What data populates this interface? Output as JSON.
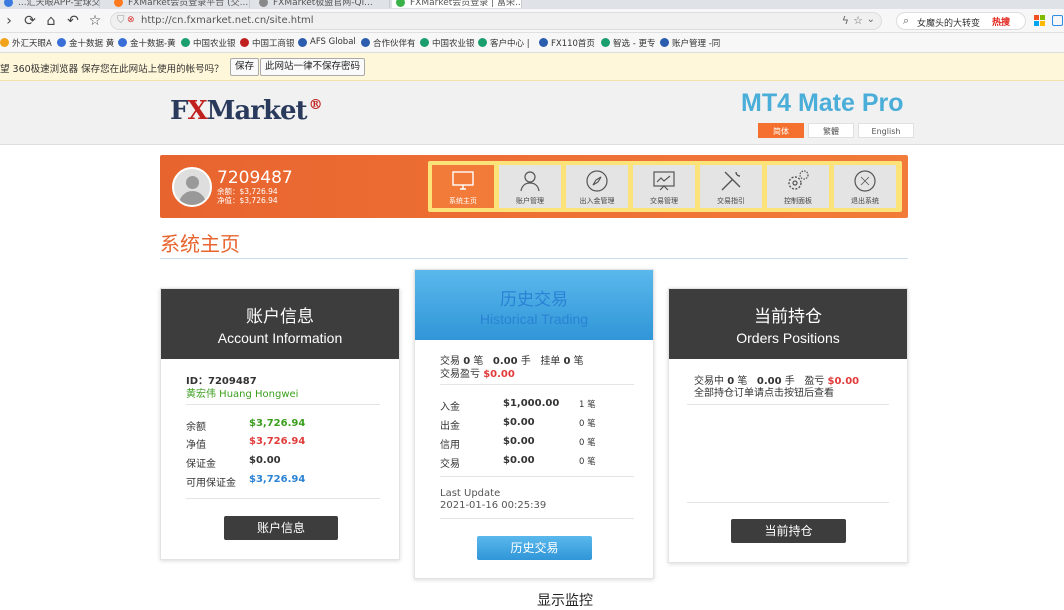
{
  "browser": {
    "tabs": [
      {
        "label": "...汇天眼APP-全球交易商监管...",
        "color": "#3b7be0"
      },
      {
        "label": "FXMarket会员登录平台 (交...",
        "color": "#ff7a1f"
      },
      {
        "label": "FXMarket极盟官网-Qi...",
        "color": "#888888"
      },
      {
        "label": "FXMarket会员登录 | 富荣...",
        "color": "#3bb14a"
      }
    ],
    "url": "http://cn.fxmarket.net.cn/site.html",
    "search_text": "女魔头的大转变",
    "hot_label": "热搜",
    "bookmarks": [
      {
        "label": "外汇天眼A",
        "color": "#f2a31b"
      },
      {
        "label": "金十数据 黄",
        "color": "#3a6fd8"
      },
      {
        "label": "金十数据-黄",
        "color": "#3a6fd8"
      },
      {
        "label": "中国农业银",
        "color": "#1a9e6e"
      },
      {
        "label": "中国工商银",
        "color": "#c0211f"
      },
      {
        "label": "AFS Global",
        "color": "#2b5cae"
      },
      {
        "label": "合作伙伴有",
        "color": "#2b5cae"
      },
      {
        "label": "中国农业银",
        "color": "#1a9e6e"
      },
      {
        "label": "客户中心 |",
        "color": "#1a9e6e"
      },
      {
        "label": "FX110首页",
        "color": "#2b5cae"
      },
      {
        "label": "智选 - 更专",
        "color": "#1a9e6e"
      },
      {
        "label": "账户管理 -同",
        "color": "#2b5cae"
      }
    ],
    "password_prompt": "望 360极速浏览器 保存您在此网站上使用的帐号吗？",
    "save_button": "保存",
    "never_button": "此网站一律不保存密码"
  },
  "header": {
    "logo_text_1": "F",
    "logo_text_x": "X",
    "logo_text_2": "Market",
    "logo_reg": "®",
    "mt4_title": "MT4 Mate Pro",
    "languages": [
      "简体",
      "繁體",
      "English"
    ]
  },
  "user": {
    "account_id": "7209487",
    "balance_line": "余额：$3,726.94",
    "equity_line": "净值：$3,726.94"
  },
  "menu": [
    {
      "label": "系统主页",
      "icon": "monitor-icon"
    },
    {
      "label": "账户管理",
      "icon": "user-icon"
    },
    {
      "label": "出入金管理",
      "icon": "compass-icon"
    },
    {
      "label": "交易管理",
      "icon": "chart-board-icon"
    },
    {
      "label": "交易指引",
      "icon": "tools-icon"
    },
    {
      "label": "控制面板",
      "icon": "gears-icon"
    },
    {
      "label": "退出系统",
      "icon": "exit-icon"
    }
  ],
  "page_title": "系统主页",
  "account_card": {
    "title_cn": "账户信息",
    "title_en": "Account Information",
    "id_line": "ID：7209487",
    "name": "黄宏伟 Huang Hongwei",
    "rows": [
      {
        "label": "余额",
        "value": "$3,726.94"
      },
      {
        "label": "净值",
        "value": "$3,726.94"
      },
      {
        "label": "保证金",
        "value": "$0.00"
      },
      {
        "label": "可用保证金",
        "value": "$3,726.94"
      }
    ],
    "button": "账户信息"
  },
  "history_card": {
    "title_cn": "历史交易",
    "title_en": "Historical Trading",
    "summary": {
      "trades_label": "交易",
      "trades_count": "0",
      "trades_unit": "笔",
      "lots": "0.00",
      "lots_unit": "手",
      "pending_label": "挂单",
      "pending_count": "0",
      "pending_unit": "笔",
      "pnl_label": "交易盈亏",
      "pnl": "$0.00"
    },
    "rows": [
      {
        "label": "入金",
        "amount": "$1,000.00",
        "count": "1 笔"
      },
      {
        "label": "出金",
        "amount": "$0.00",
        "count": "0 笔"
      },
      {
        "label": "信用",
        "amount": "$0.00",
        "count": "0 笔"
      },
      {
        "label": "交易",
        "amount": "$0.00",
        "count": "0 笔"
      }
    ],
    "last_update_label": "Last Update",
    "last_update": "2021-01-16 00:25:39",
    "button": "历史交易"
  },
  "positions_card": {
    "title_cn": "当前持仓",
    "title_en": "Orders Positions",
    "active_label": "交易中",
    "active_count": "0",
    "active_unit": "笔",
    "lots": "0.00",
    "lots_unit": "手",
    "pnl_label": "盈亏",
    "pnl": "$0.00",
    "note": "全部持仓订单请点击按钮后查看",
    "button": "当前持仓"
  },
  "cut_heading": "显示监控",
  "colors": {
    "accent_orange": "#e8642f",
    "brand_blue": "#4aaed9",
    "dark_header": "#3d3d3d",
    "profit_green": "#3a9f1d",
    "loss_red": "#e23b3b"
  }
}
